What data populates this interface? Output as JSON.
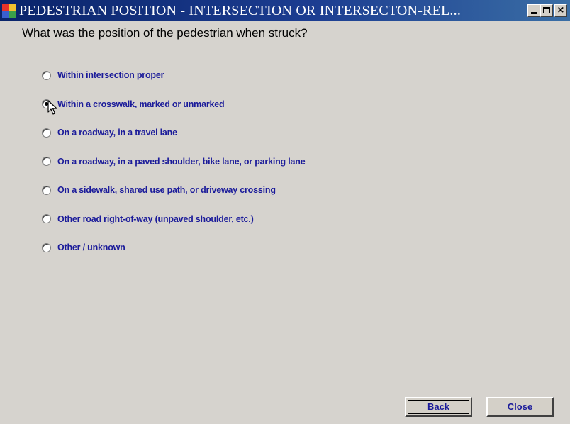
{
  "window": {
    "title": "PEDESTRIAN POSITION - INTERSECTION OR INTERSECTON-REL...",
    "controls": {
      "minimize_label": "_",
      "maximize_label": "□",
      "close_label": "×"
    }
  },
  "form": {
    "question": "What was the position of the pedestrian when struck?",
    "selected_index": 1,
    "options": [
      {
        "label": "Within intersection proper",
        "checked": false
      },
      {
        "label": "Within a crosswalk, marked or unmarked",
        "checked": true
      },
      {
        "label": "On a roadway, in a travel lane",
        "checked": false
      },
      {
        "label": "On a roadway, in a paved shoulder, bike lane, or parking lane",
        "checked": false
      },
      {
        "label": "On a sidewalk, shared use path, or driveway crossing",
        "checked": false
      },
      {
        "label": "Other road right-of-way (unpaved shoulder, etc.)",
        "checked": false
      },
      {
        "label": "Other / unknown",
        "checked": false
      }
    ]
  },
  "buttons": {
    "back_label": "Back",
    "close_label": "Close"
  },
  "colors": {
    "titlebar_start": "#0a246a",
    "titlebar_end": "#3a6ea5",
    "window_bg": "#d6d3ce",
    "option_text": "#1b1b9a"
  }
}
